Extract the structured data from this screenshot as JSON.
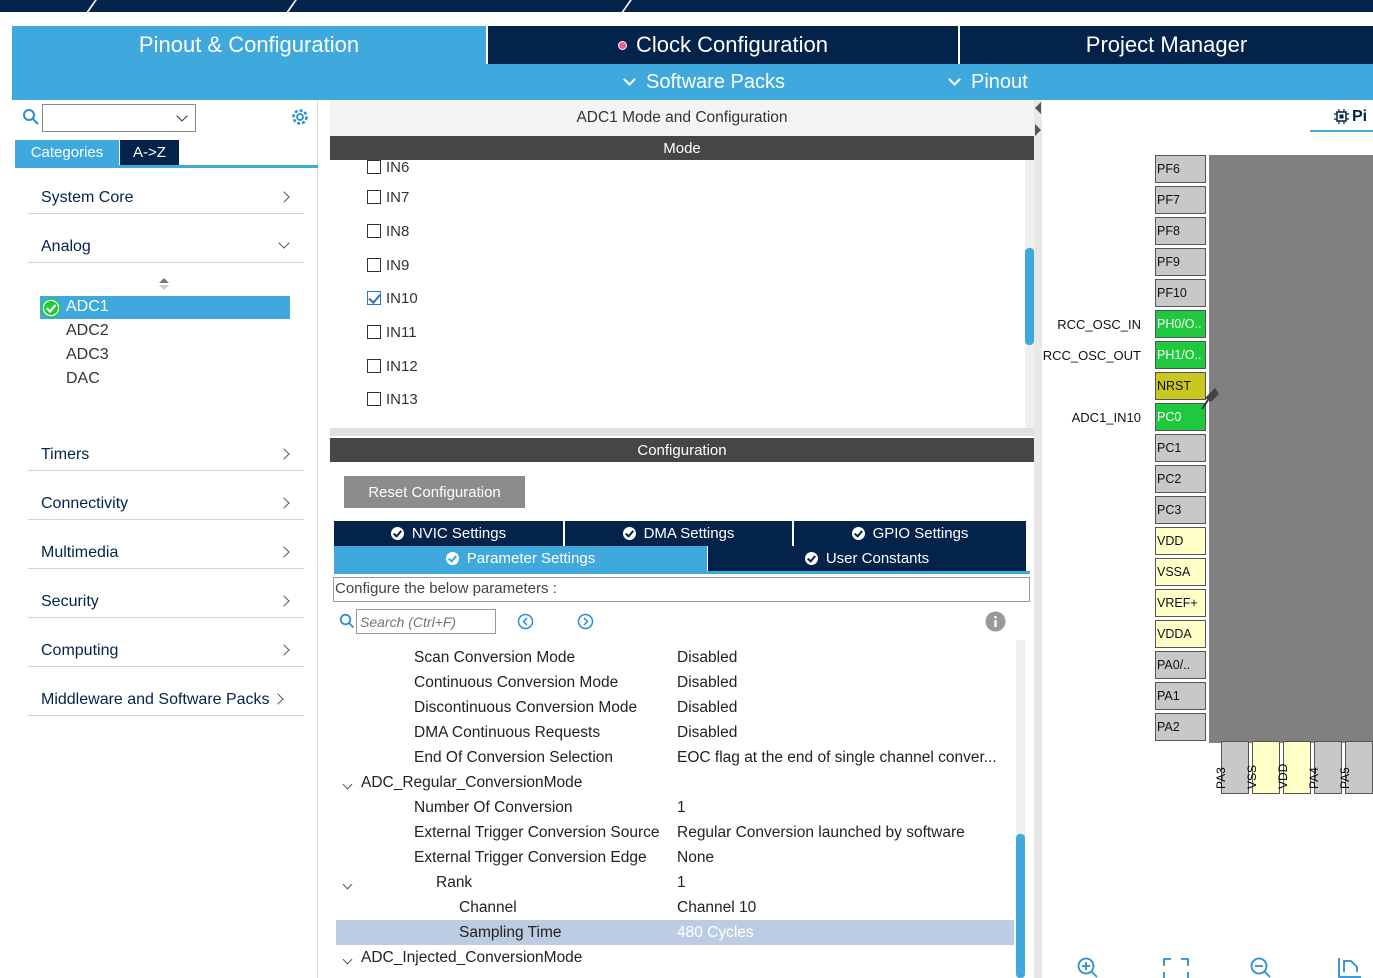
{
  "main_tabs": [
    {
      "label": "Pinout & Configuration",
      "active": true
    },
    {
      "label": "Clock Configuration",
      "active": false,
      "dot": true
    },
    {
      "label": "Project Manager",
      "active": false
    }
  ],
  "sub_menu": [
    {
      "label": "Software Packs"
    },
    {
      "label": "Pinout"
    }
  ],
  "left": {
    "search_value": "",
    "view_tabs": [
      {
        "label": "Categories",
        "active": true
      },
      {
        "label": "A->Z",
        "active": false
      }
    ],
    "categories": [
      {
        "label": "System Core",
        "expanded": false
      },
      {
        "label": "Analog",
        "expanded": true
      },
      {
        "label": "Timers",
        "expanded": false
      },
      {
        "label": "Connectivity",
        "expanded": false
      },
      {
        "label": "Multimedia",
        "expanded": false
      },
      {
        "label": "Security",
        "expanded": false
      },
      {
        "label": "Computing",
        "expanded": false
      },
      {
        "label": "Middleware and Software Packs",
        "expanded": false
      }
    ],
    "analog_items": [
      {
        "label": "ADC1",
        "selected": true,
        "enabled": true
      },
      {
        "label": "ADC2",
        "selected": false
      },
      {
        "label": "ADC3",
        "selected": false
      },
      {
        "label": "DAC",
        "selected": false
      }
    ]
  },
  "center": {
    "title": "ADC1 Mode and Configuration",
    "mode_header": "Mode",
    "mode_inputs": [
      {
        "label": "IN6",
        "checked": false,
        "partial": true
      },
      {
        "label": "IN7",
        "checked": false
      },
      {
        "label": "IN8",
        "checked": false
      },
      {
        "label": "IN9",
        "checked": false
      },
      {
        "label": "IN10",
        "checked": true
      },
      {
        "label": "IN11",
        "checked": false
      },
      {
        "label": "IN12",
        "checked": false
      },
      {
        "label": "IN13",
        "checked": false
      }
    ],
    "config_header": "Configuration",
    "reset_label": "Reset Configuration",
    "settings_tabs_row1": [
      "NVIC Settings",
      "DMA Settings",
      "GPIO Settings"
    ],
    "settings_tabs_row2": [
      {
        "label": "Parameter Settings",
        "active": true
      },
      {
        "label": "User Constants",
        "active": false
      }
    ],
    "configure_text": "Configure the below parameters :",
    "search_placeholder": "Search (Ctrl+F)",
    "params": [
      {
        "name": "Scan Conversion Mode",
        "value": "Disabled",
        "indent": 1
      },
      {
        "name": "Continuous Conversion Mode",
        "value": "Disabled",
        "indent": 1
      },
      {
        "name": "Discontinuous Conversion Mode",
        "value": "Disabled",
        "indent": 1
      },
      {
        "name": "DMA Continuous Requests",
        "value": "Disabled",
        "indent": 1
      },
      {
        "name": "End Of Conversion Selection",
        "value": "EOC flag at the end of single channel conver...",
        "indent": 1
      },
      {
        "name": "ADC_Regular_ConversionMode",
        "value": "",
        "indent": 0,
        "group": true
      },
      {
        "name": "Number Of Conversion",
        "value": "1",
        "indent": 1
      },
      {
        "name": "External Trigger Conversion Source",
        "value": "Regular Conversion launched by software",
        "indent": 1
      },
      {
        "name": "External Trigger Conversion Edge",
        "value": "None",
        "indent": 1
      },
      {
        "name": "Rank",
        "value": "1",
        "indent": 2,
        "group": true
      },
      {
        "name": "Channel",
        "value": "Channel 10",
        "indent": 3
      },
      {
        "name": "Sampling Time",
        "value": "480 Cycles",
        "indent": 3,
        "selected": true
      },
      {
        "name": "ADC_Injected_ConversionMode",
        "value": "",
        "indent": 0,
        "group": true
      }
    ]
  },
  "right": {
    "view_tab": "Pi",
    "left_pins": [
      {
        "name": "PF6",
        "type": "grey",
        "label": ""
      },
      {
        "name": "PF7",
        "type": "grey",
        "label": ""
      },
      {
        "name": "PF8",
        "type": "grey",
        "label": ""
      },
      {
        "name": "PF9",
        "type": "grey",
        "label": ""
      },
      {
        "name": "PF10",
        "type": "grey",
        "label": ""
      },
      {
        "name": "PH0/O..",
        "type": "green",
        "label": "RCC_OSC_IN"
      },
      {
        "name": "PH1/O..",
        "type": "green",
        "label": "RCC_OSC_OUT"
      },
      {
        "name": "NRST",
        "type": "yellow",
        "label": ""
      },
      {
        "name": "PC0",
        "type": "green",
        "label": "ADC1_IN10"
      },
      {
        "name": "PC1",
        "type": "grey",
        "label": ""
      },
      {
        "name": "PC2",
        "type": "grey",
        "label": ""
      },
      {
        "name": "PC3",
        "type": "grey",
        "label": ""
      },
      {
        "name": "VDD",
        "type": "cream",
        "label": ""
      },
      {
        "name": "VSSA",
        "type": "cream",
        "label": ""
      },
      {
        "name": "VREF+",
        "type": "cream",
        "label": ""
      },
      {
        "name": "VDDA",
        "type": "cream",
        "label": ""
      },
      {
        "name": "PA0/..",
        "type": "grey",
        "label": ""
      },
      {
        "name": "PA1",
        "type": "grey",
        "label": ""
      },
      {
        "name": "PA2",
        "type": "grey",
        "label": ""
      }
    ],
    "bottom_pins": [
      {
        "name": "PA3",
        "type": "grey"
      },
      {
        "name": "VSS",
        "type": "cream"
      },
      {
        "name": "VDD",
        "type": "cream"
      },
      {
        "name": "PA4",
        "type": "grey"
      },
      {
        "name": "PA5",
        "type": "grey"
      }
    ]
  },
  "colors": {
    "navy": "#03234b",
    "accent": "#3fa9dd",
    "pin_green": "#1fc83c",
    "pin_yellow": "#c8c81e"
  }
}
